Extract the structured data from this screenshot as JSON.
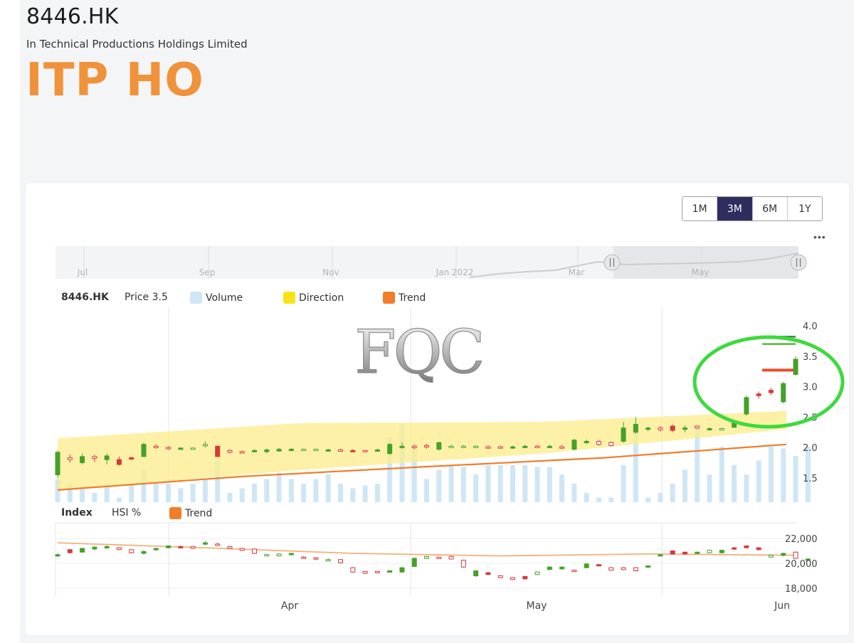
{
  "header": {
    "ticker": "8446.HK",
    "company": "In Technical Productions Holdings Limited",
    "short_name": "ITP HO"
  },
  "range_buttons": [
    {
      "label": "1M",
      "active": false
    },
    {
      "label": "3M",
      "active": true
    },
    {
      "label": "6M",
      "active": false
    },
    {
      "label": "1Y",
      "active": false
    }
  ],
  "watermark": "FQC",
  "navigator": {
    "labels": [
      "Jul",
      "Sep",
      "Nov",
      "Jan 2022",
      "Mar",
      "May"
    ]
  },
  "legend": {
    "price": {
      "symbol": "8446.HK",
      "price_label": "Price 3.5",
      "volume": "Volume",
      "direction": "Direction",
      "trend": "Trend"
    },
    "index": {
      "name": "Index",
      "measure": "HSI %",
      "trend": "Trend"
    }
  },
  "colors": {
    "up": "#45a12a",
    "down": "#d23a3a",
    "volume": "#cfe6f5",
    "direction": "#fbec8a",
    "trend": "#f07d28",
    "highlight_circle": "#3ed93e",
    "accent": "#f0923a",
    "button_active": "#2f2d5e"
  },
  "chart_data": [
    {
      "type": "candlestick",
      "title": "8446.HK",
      "ylim": [
        1.1,
        4.0
      ],
      "y_ticks": [
        "1.5",
        "2.0",
        "2.5",
        "3.0",
        "3.5",
        "4.0"
      ],
      "x_ticks": [
        "Apr",
        "May",
        "Jun"
      ],
      "candles": [
        {
          "o": 1.55,
          "c": 1.92,
          "h": 1.95,
          "l": 1.5,
          "up": true
        },
        {
          "o": 1.83,
          "c": 1.8,
          "h": 1.88,
          "l": 1.75,
          "up": false
        },
        {
          "o": 1.75,
          "c": 1.85,
          "h": 1.9,
          "l": 1.72,
          "up": true
        },
        {
          "o": 1.85,
          "c": 1.82,
          "h": 1.88,
          "l": 1.76,
          "up": false
        },
        {
          "o": 1.8,
          "c": 1.86,
          "h": 1.9,
          "l": 1.72,
          "up": true
        },
        {
          "o": 1.72,
          "c": 1.8,
          "h": 1.85,
          "l": 1.7,
          "up": false
        },
        {
          "o": 1.82,
          "c": 1.83,
          "h": 1.85,
          "l": 1.8,
          "up": false
        },
        {
          "o": 1.85,
          "c": 2.05,
          "h": 2.08,
          "l": 1.85,
          "up": true
        },
        {
          "o": 2.02,
          "c": 2.0,
          "h": 2.05,
          "l": 1.98,
          "up": false
        },
        {
          "o": 2.0,
          "c": 1.98,
          "h": 2.02,
          "l": 1.96,
          "up": false
        },
        {
          "o": 1.98,
          "c": 1.99,
          "h": 2.0,
          "l": 1.96,
          "up": true
        },
        {
          "o": 1.99,
          "c": 1.98,
          "h": 2.0,
          "l": 1.97,
          "up": true
        },
        {
          "o": 2.05,
          "c": 2.04,
          "h": 2.1,
          "l": 2.0,
          "up": true
        },
        {
          "o": 1.85,
          "c": 2.02,
          "h": 2.03,
          "l": 1.84,
          "up": false
        },
        {
          "o": 1.95,
          "c": 1.92,
          "h": 1.97,
          "l": 1.9,
          "up": false
        },
        {
          "o": 1.93,
          "c": 1.92,
          "h": 1.95,
          "l": 1.9,
          "up": false
        },
        {
          "o": 1.94,
          "c": 1.95,
          "h": 1.97,
          "l": 1.93,
          "up": true
        },
        {
          "o": 1.93,
          "c": 1.96,
          "h": 1.98,
          "l": 1.9,
          "up": true
        },
        {
          "o": 1.94,
          "c": 1.97,
          "h": 1.99,
          "l": 1.93,
          "up": true
        },
        {
          "o": 1.95,
          "c": 1.97,
          "h": 1.99,
          "l": 1.94,
          "up": true
        },
        {
          "o": 1.97,
          "c": 1.96,
          "h": 1.98,
          "l": 1.95,
          "up": true
        },
        {
          "o": 1.97,
          "c": 1.96,
          "h": 1.98,
          "l": 1.95,
          "up": true
        },
        {
          "o": 1.96,
          "c": 1.96,
          "h": 1.98,
          "l": 1.94,
          "up": true
        },
        {
          "o": 1.96,
          "c": 1.95,
          "h": 1.98,
          "l": 1.93,
          "up": false
        },
        {
          "o": 1.94,
          "c": 1.95,
          "h": 1.97,
          "l": 1.93,
          "up": false
        },
        {
          "o": 1.95,
          "c": 1.94,
          "h": 1.96,
          "l": 1.93,
          "up": false
        },
        {
          "o": 1.94,
          "c": 1.96,
          "h": 1.98,
          "l": 1.93,
          "up": true
        },
        {
          "o": 1.9,
          "c": 2.05,
          "h": 2.07,
          "l": 1.88,
          "up": true
        },
        {
          "o": 2.0,
          "c": 2.02,
          "h": 2.08,
          "l": 1.98,
          "up": true
        },
        {
          "o": 2.02,
          "c": 2.01,
          "h": 2.05,
          "l": 1.97,
          "up": false
        },
        {
          "o": 2.03,
          "c": 2.01,
          "h": 2.06,
          "l": 1.98,
          "up": false
        },
        {
          "o": 1.97,
          "c": 2.08,
          "h": 2.09,
          "l": 1.95,
          "up": true
        },
        {
          "o": 2.02,
          "c": 2.01,
          "h": 2.04,
          "l": 1.99,
          "up": true
        },
        {
          "o": 2.02,
          "c": 2.01,
          "h": 2.04,
          "l": 1.99,
          "up": true
        },
        {
          "o": 2.02,
          "c": 2.01,
          "h": 2.03,
          "l": 1.99,
          "up": true
        },
        {
          "o": 2.01,
          "c": 2.0,
          "h": 2.03,
          "l": 1.98,
          "up": false
        },
        {
          "o": 2.01,
          "c": 2.0,
          "h": 2.03,
          "l": 1.98,
          "up": false
        },
        {
          "o": 2.0,
          "c": 2.01,
          "h": 2.03,
          "l": 1.98,
          "up": true
        },
        {
          "o": 2.01,
          "c": 2.02,
          "h": 2.04,
          "l": 1.99,
          "up": true
        },
        {
          "o": 2.02,
          "c": 2.01,
          "h": 2.04,
          "l": 1.99,
          "up": false
        },
        {
          "o": 2.01,
          "c": 2.02,
          "h": 2.04,
          "l": 1.99,
          "up": true
        },
        {
          "o": 2.01,
          "c": 2.0,
          "h": 2.04,
          "l": 1.98,
          "up": false
        },
        {
          "o": 1.97,
          "c": 2.12,
          "h": 2.14,
          "l": 1.95,
          "up": true
        },
        {
          "o": 2.08,
          "c": 2.1,
          "h": 2.13,
          "l": 2.05,
          "up": true
        },
        {
          "o": 2.1,
          "c": 2.05,
          "h": 2.12,
          "l": 2.03,
          "up": false
        },
        {
          "o": 2.08,
          "c": 2.03,
          "h": 2.1,
          "l": 2.02,
          "up": false
        },
        {
          "o": 2.1,
          "c": 2.32,
          "h": 2.42,
          "l": 2.08,
          "up": true
        },
        {
          "o": 2.25,
          "c": 2.38,
          "h": 2.5,
          "l": 2.22,
          "up": true
        },
        {
          "o": 2.3,
          "c": 2.32,
          "h": 2.34,
          "l": 2.27,
          "up": true
        },
        {
          "o": 2.32,
          "c": 2.29,
          "h": 2.35,
          "l": 2.26,
          "up": false
        },
        {
          "o": 2.28,
          "c": 2.35,
          "h": 2.38,
          "l": 2.25,
          "up": false
        },
        {
          "o": 2.32,
          "c": 2.32,
          "h": 2.36,
          "l": 2.25,
          "up": true
        },
        {
          "o": 2.35,
          "c": 2.32,
          "h": 2.36,
          "l": 2.3,
          "up": false
        },
        {
          "o": 2.31,
          "c": 2.31,
          "h": 2.33,
          "l": 2.29,
          "up": true
        },
        {
          "o": 2.31,
          "c": 2.3,
          "h": 2.32,
          "l": 2.29,
          "up": true
        },
        {
          "o": 2.33,
          "c": 2.41,
          "h": 2.43,
          "l": 2.33,
          "up": true
        },
        {
          "o": 2.55,
          "c": 2.82,
          "h": 2.85,
          "l": 2.52,
          "up": true
        },
        {
          "o": 2.85,
          "c": 2.88,
          "h": 2.92,
          "l": 2.8,
          "up": false
        },
        {
          "o": 2.9,
          "c": 2.94,
          "h": 2.98,
          "l": 2.86,
          "up": false
        },
        {
          "o": 2.75,
          "c": 3.05,
          "h": 3.08,
          "l": 2.72,
          "up": true
        },
        {
          "o": 3.2,
          "c": 3.45,
          "h": 3.5,
          "l": 3.18,
          "up": true
        }
      ],
      "volume_relative": [
        0.25,
        0.2,
        0.15,
        0.1,
        0.2,
        0.05,
        0.2,
        0.35,
        0.2,
        0.2,
        0.15,
        0.2,
        0.25,
        0.45,
        0.1,
        0.15,
        0.2,
        0.25,
        0.32,
        0.25,
        0.2,
        0.25,
        0.3,
        0.2,
        0.15,
        0.18,
        0.2,
        0.7,
        0.85,
        0.6,
        0.25,
        0.35,
        0.4,
        0.38,
        0.3,
        0.4,
        0.4,
        0.4,
        0.4,
        0.38,
        0.38,
        0.3,
        0.2,
        0.1,
        0.05,
        0.05,
        0.4,
        0.8,
        0.05,
        0.1,
        0.2,
        0.35,
        0.85,
        0.3,
        0.6,
        0.4,
        0.3,
        0.45,
        0.6,
        0.58,
        0.5,
        0.6
      ],
      "direction_band": {
        "upper": [
          2.15,
          2.4,
          2.42,
          2.6
        ],
        "lower": [
          1.3,
          1.63,
          1.9,
          2.3
        ]
      },
      "trend": [
        1.3,
        1.52,
        1.68,
        1.83,
        2.05
      ],
      "reference_lines": [
        {
          "value": 3.82,
          "color": "#3a8a3a"
        },
        {
          "value": 3.7,
          "color": "#58b53e"
        },
        {
          "value": 3.27,
          "color": "#e84f2a"
        }
      ]
    },
    {
      "type": "candlestick",
      "title": "Index",
      "ylim": [
        17000,
        23000
      ],
      "y_ticks": [
        "18,000",
        "20,000",
        "22,000"
      ],
      "x_ticks": [
        "Apr",
        "May",
        "Jun"
      ],
      "candles": [
        {
          "o": 20650,
          "c": 20700,
          "h": 20800,
          "l": 20500,
          "up": true
        },
        {
          "o": 20850,
          "c": 21100,
          "h": 21150,
          "l": 20800,
          "up": false
        },
        {
          "o": 20900,
          "c": 21200,
          "h": 21250,
          "l": 20850,
          "up": true
        },
        {
          "o": 21150,
          "c": 21300,
          "h": 21400,
          "l": 21050,
          "up": true
        },
        {
          "o": 21300,
          "c": 21350,
          "h": 21450,
          "l": 21150,
          "up": true
        },
        {
          "o": 21250,
          "c": 21100,
          "h": 21300,
          "l": 21050,
          "up": false
        },
        {
          "o": 21100,
          "c": 20850,
          "h": 21150,
          "l": 20800,
          "up": false
        },
        {
          "o": 20800,
          "c": 20950,
          "h": 21050,
          "l": 20700,
          "up": true
        },
        {
          "o": 21100,
          "c": 21200,
          "h": 21250,
          "l": 21000,
          "up": true
        },
        {
          "o": 21250,
          "c": 21400,
          "h": 21450,
          "l": 21200,
          "up": true
        },
        {
          "o": 21300,
          "c": 21350,
          "h": 21450,
          "l": 21200,
          "up": false
        },
        {
          "o": 21350,
          "c": 21200,
          "h": 21400,
          "l": 21150,
          "up": false
        },
        {
          "o": 21550,
          "c": 21650,
          "h": 21800,
          "l": 21450,
          "up": true
        },
        {
          "o": 21550,
          "c": 21450,
          "h": 21650,
          "l": 21400,
          "up": false
        },
        {
          "o": 21350,
          "c": 21200,
          "h": 21400,
          "l": 21150,
          "up": false
        },
        {
          "o": 21200,
          "c": 21050,
          "h": 21250,
          "l": 21000,
          "up": false
        },
        {
          "o": 21150,
          "c": 20800,
          "h": 21200,
          "l": 20750,
          "up": false
        },
        {
          "o": 20700,
          "c": 20650,
          "h": 20750,
          "l": 20600,
          "up": true
        },
        {
          "o": 20750,
          "c": 20600,
          "h": 20800,
          "l": 20550,
          "up": true
        },
        {
          "o": 20750,
          "c": 20800,
          "h": 20850,
          "l": 20700,
          "up": true
        },
        {
          "o": 20500,
          "c": 20450,
          "h": 20600,
          "l": 20350,
          "up": false
        },
        {
          "o": 20450,
          "c": 20350,
          "h": 20500,
          "l": 20250,
          "up": false
        },
        {
          "o": 20300,
          "c": 20250,
          "h": 20400,
          "l": 20200,
          "up": true
        },
        {
          "o": 20300,
          "c": 20050,
          "h": 20350,
          "l": 20000,
          "up": false
        },
        {
          "o": 19650,
          "c": 19300,
          "h": 19700,
          "l": 19250,
          "up": false
        },
        {
          "o": 19350,
          "c": 19200,
          "h": 19400,
          "l": 19150,
          "up": false
        },
        {
          "o": 19350,
          "c": 19250,
          "h": 19400,
          "l": 19200,
          "up": false
        },
        {
          "o": 19350,
          "c": 19400,
          "h": 19450,
          "l": 19300,
          "up": true
        },
        {
          "o": 19300,
          "c": 19650,
          "h": 19700,
          "l": 19250,
          "up": true
        },
        {
          "o": 19750,
          "c": 20400,
          "h": 20500,
          "l": 19700,
          "up": true
        },
        {
          "o": 20550,
          "c": 20400,
          "h": 20600,
          "l": 20350,
          "up": true
        },
        {
          "o": 20500,
          "c": 20450,
          "h": 20550,
          "l": 20400,
          "up": false
        },
        {
          "o": 20550,
          "c": 20350,
          "h": 20600,
          "l": 20300,
          "up": false
        },
        {
          "o": 20250,
          "c": 19700,
          "h": 20300,
          "l": 19650,
          "up": false
        },
        {
          "o": 19000,
          "c": 19400,
          "h": 19450,
          "l": 18900,
          "up": true
        },
        {
          "o": 19100,
          "c": 19250,
          "h": 19300,
          "l": 19050,
          "up": false
        },
        {
          "o": 19000,
          "c": 18850,
          "h": 19050,
          "l": 18800,
          "up": false
        },
        {
          "o": 18850,
          "c": 18700,
          "h": 18900,
          "l": 18650,
          "up": false
        },
        {
          "o": 18750,
          "c": 18950,
          "h": 19000,
          "l": 18700,
          "up": false
        },
        {
          "o": 19300,
          "c": 19100,
          "h": 19350,
          "l": 19050,
          "up": true
        },
        {
          "o": 19500,
          "c": 19700,
          "h": 19750,
          "l": 19450,
          "up": true
        },
        {
          "o": 19550,
          "c": 19700,
          "h": 19750,
          "l": 19500,
          "up": true
        },
        {
          "o": 19450,
          "c": 19400,
          "h": 19500,
          "l": 19350,
          "up": false
        },
        {
          "o": 19650,
          "c": 19950,
          "h": 20000,
          "l": 19600,
          "up": true
        },
        {
          "o": 19850,
          "c": 19900,
          "h": 19950,
          "l": 19800,
          "up": false
        },
        {
          "o": 19650,
          "c": 19450,
          "h": 19700,
          "l": 19400,
          "up": false
        },
        {
          "o": 19650,
          "c": 19500,
          "h": 19700,
          "l": 19450,
          "up": false
        },
        {
          "o": 19650,
          "c": 19400,
          "h": 19700,
          "l": 19350,
          "up": false
        },
        {
          "o": 19750,
          "c": 19800,
          "h": 19850,
          "l": 19700,
          "up": true
        },
        {
          "o": 20600,
          "c": 20700,
          "h": 20750,
          "l": 20550,
          "up": true
        },
        {
          "o": 20750,
          "c": 21000,
          "h": 21050,
          "l": 20700,
          "up": false
        },
        {
          "o": 20750,
          "c": 20900,
          "h": 20950,
          "l": 20700,
          "up": false
        },
        {
          "o": 20800,
          "c": 20900,
          "h": 20950,
          "l": 20750,
          "up": true
        },
        {
          "o": 21050,
          "c": 20850,
          "h": 21100,
          "l": 20800,
          "up": true
        },
        {
          "o": 20850,
          "c": 21050,
          "h": 21100,
          "l": 20800,
          "up": true
        },
        {
          "o": 21150,
          "c": 21250,
          "h": 21300,
          "l": 21100,
          "up": false
        },
        {
          "o": 21250,
          "c": 21400,
          "h": 21450,
          "l": 21200,
          "up": false
        },
        {
          "o": 21100,
          "c": 21250,
          "h": 21300,
          "l": 21050,
          "up": false
        },
        {
          "o": 20650,
          "c": 20500,
          "h": 20700,
          "l": 20450,
          "up": true
        },
        {
          "o": 20650,
          "c": 20800,
          "h": 20850,
          "l": 20550,
          "up": true
        },
        {
          "o": 20900,
          "c": 20400,
          "h": 20950,
          "l": 20350,
          "up": false
        },
        {
          "o": 20300,
          "c": 20350,
          "h": 20400,
          "l": 20250,
          "up": true
        }
      ],
      "trend": [
        21650,
        21250,
        20800,
        20600,
        20750,
        20650
      ]
    }
  ]
}
